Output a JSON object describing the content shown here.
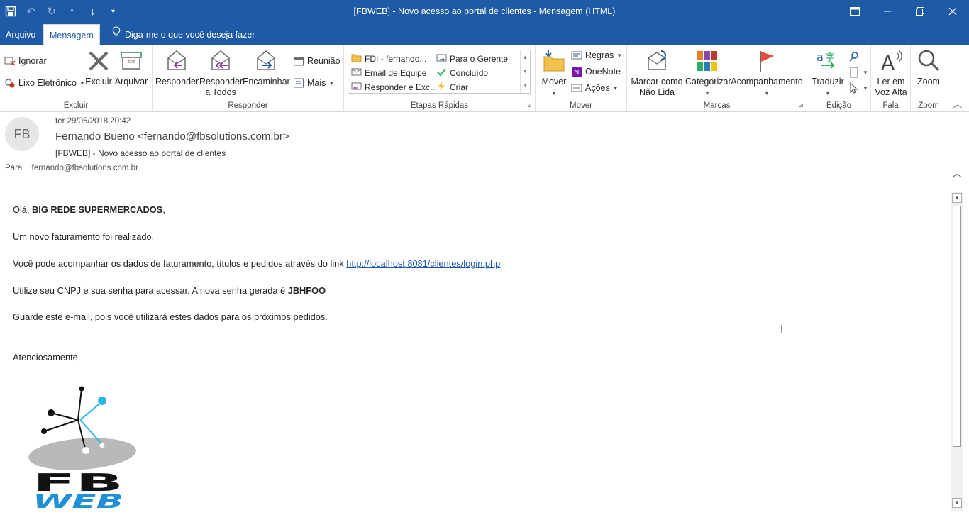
{
  "window": {
    "title": "[FBWEB] - Novo acesso ao portal de clientes  -  Mensagem (HTML)",
    "accent": "#1e5aa6"
  },
  "qat": {
    "icons": [
      "save-icon",
      "undo-icon",
      "redo-icon",
      "previous-item-icon",
      "next-item-icon",
      "customize-qat-icon"
    ],
    "glyphs": [
      "🖫",
      "↶",
      "↻",
      "↑",
      "↓",
      "▾"
    ]
  },
  "tabs": [
    {
      "label": "Arquivo"
    },
    {
      "label": "Mensagem",
      "active": true
    }
  ],
  "tellme": "Diga-me o que você deseja fazer",
  "ribbon": {
    "excluir": {
      "label": "Excluir",
      "ignore": "Ignorar",
      "junk": "Lixo Eletrônico",
      "delete": "Excluir",
      "archive": "Arquivar"
    },
    "responder": {
      "label": "Responder",
      "reply": "Responder",
      "reply_all_1": "Responder",
      "reply_all_2": "a Todos",
      "forward": "Encaminhar",
      "meeting": "Reunião",
      "more": "Mais"
    },
    "quicksteps": {
      "label": "Etapas Rápidas",
      "items": [
        "FDI - fernando...",
        "Email de Equipe",
        "Responder e Exc...",
        "Para o Gerente",
        "Concluído",
        "Criar"
      ]
    },
    "mover": {
      "label": "Mover",
      "move": "Mover",
      "rules": "Regras",
      "onenote": "OneNote",
      "actions": "Ações"
    },
    "marcas": {
      "label": "Marcas",
      "unread_1": "Marcar como",
      "unread_2": "Não Lida",
      "categorize": "Categorizar",
      "followup": "Acompanhamento"
    },
    "edicao": {
      "label": "Edição",
      "translate": "Traduzir"
    },
    "fala": {
      "label": "Fala",
      "read_1": "Ler em",
      "read_2": "Voz Alta"
    },
    "zoom": {
      "label": "Zoom",
      "zoom": "Zoom"
    }
  },
  "message": {
    "avatar_initials": "FB",
    "date": "ter 29/05/2018 20:42",
    "from": "Fernando Bueno <fernando@fbsolutions.com.br>",
    "subject": "[FBWEB] - Novo acesso ao portal de clientes",
    "to_label": "Para",
    "to_address": "fernando@fbsolutions.com.br"
  },
  "body": {
    "greeting_prefix": "Olá, ",
    "greeting_name": "BIG REDE SUPERMERCADOS",
    "greeting_suffix": ",",
    "line1": "Um novo faturamento foi realizado.",
    "line2_prefix": "Você pode acompanhar os dados de faturamento, títulos e pedidos através do link ",
    "line2_link": "http://localhost:8081/clientes/login.php",
    "line3_prefix": "Utilize seu CNPJ e sua senha para acessar. A nova senha gerada é ",
    "line3_password": "JBHFOO",
    "line4": "Guarde este e-mail, pois você utilizará estes dados para os próximos pedidos.",
    "signoff": "Atenciosamente,",
    "logo_text_top": "FB",
    "logo_text_bottom": "WEB"
  }
}
